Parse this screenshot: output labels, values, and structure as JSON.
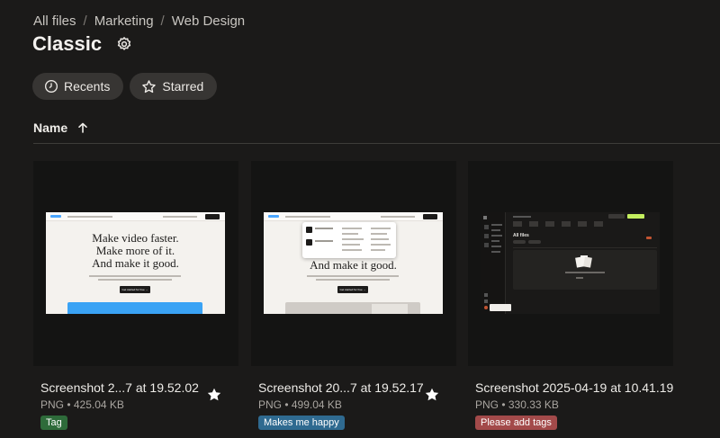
{
  "breadcrumb": {
    "items": [
      "All files",
      "Marketing",
      "Web Design"
    ],
    "separator": "/"
  },
  "page": {
    "title": "Classic"
  },
  "filters": {
    "recents_label": "Recents",
    "starred_label": "Starred"
  },
  "table": {
    "sort_label": "Name"
  },
  "files": [
    {
      "name": "Screenshot 2...7 at 19.52.02",
      "meta": "PNG • 425.04 KB",
      "tag": "Tag",
      "tag_color": "#2e6b3a",
      "starred": true,
      "preview": {
        "headline": [
          "Make video faster.",
          "Make more of it.",
          "And make it good."
        ],
        "button": "Get started for free →"
      }
    },
    {
      "name": "Screenshot 20...7 at 19.52.17",
      "meta": "PNG • 499.04 KB",
      "tag": "Makes me happy",
      "tag_color": "#2f6a90",
      "starred": true,
      "preview": {
        "headline": [
          "And make it good."
        ],
        "button": "Get started for free →"
      }
    },
    {
      "name": "Screenshot 2025-04-19 at 10.41.19",
      "meta": "PNG • 330.33 KB",
      "tag": "Please add tags",
      "tag_color": "#a34a4a",
      "starred": false,
      "preview": {
        "heading": "All files"
      }
    }
  ]
}
